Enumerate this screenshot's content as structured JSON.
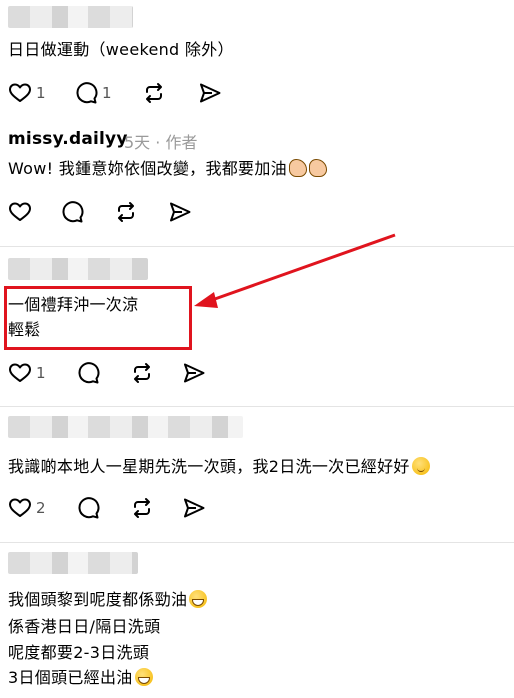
{
  "posts": [
    {
      "text_lines": [
        "日日做運動（weekend 除外）"
      ],
      "likes": "1",
      "replies": "1"
    },
    {
      "username": "missy.dailyy",
      "time": "5天",
      "separator": "·",
      "role": "作者",
      "text_lines": [
        "Wow! 我鍾意妳依個改變，我都要加油"
      ],
      "emoji": "muscle-emoji"
    },
    {
      "text_lines": [
        "一個禮拜沖一次涼",
        "輕鬆"
      ],
      "likes": "1"
    },
    {
      "text_lines": [
        "我識啲本地人一星期先洗一次頭，我2日洗一次已經好好"
      ],
      "emoji": "relieved-face-emoji",
      "likes": "2"
    },
    {
      "text_lines": [
        "我個頭黎到呢度都係勁油",
        "係香港日日/隔日洗頭",
        "呢度都要2-3日洗頭",
        "3日個頭已經出油"
      ],
      "emoji": "grinning-sweat-emoji"
    }
  ],
  "colors": {
    "highlight": "#e0141e",
    "arrow": "#e0141e",
    "meta": "#9a9a9a"
  }
}
